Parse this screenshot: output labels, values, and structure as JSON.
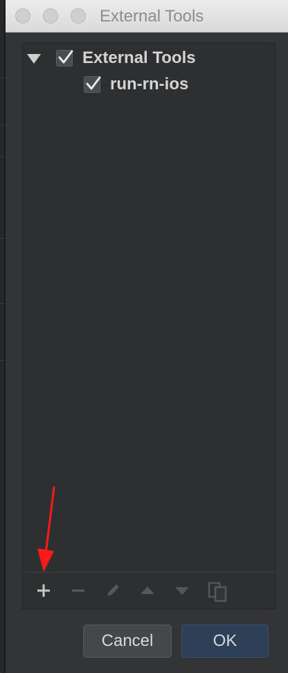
{
  "window": {
    "title": "External Tools"
  },
  "tree": {
    "root": {
      "label": "External Tools",
      "checked": true,
      "expanded": true
    },
    "children": [
      {
        "label": "run-rn-ios",
        "checked": true
      }
    ]
  },
  "toolbar": {
    "actions": [
      "add-icon",
      "remove-icon",
      "edit-icon",
      "move-up-icon",
      "move-down-icon",
      "copy-icon"
    ]
  },
  "buttons": {
    "cancel_label": "Cancel",
    "ok_label": "OK"
  },
  "colors": {
    "dialog_bg": "#333436",
    "panel_bg": "#2e2f31",
    "ok_button": "#2e3f58",
    "annotation_arrow": "#ff1a1a"
  }
}
